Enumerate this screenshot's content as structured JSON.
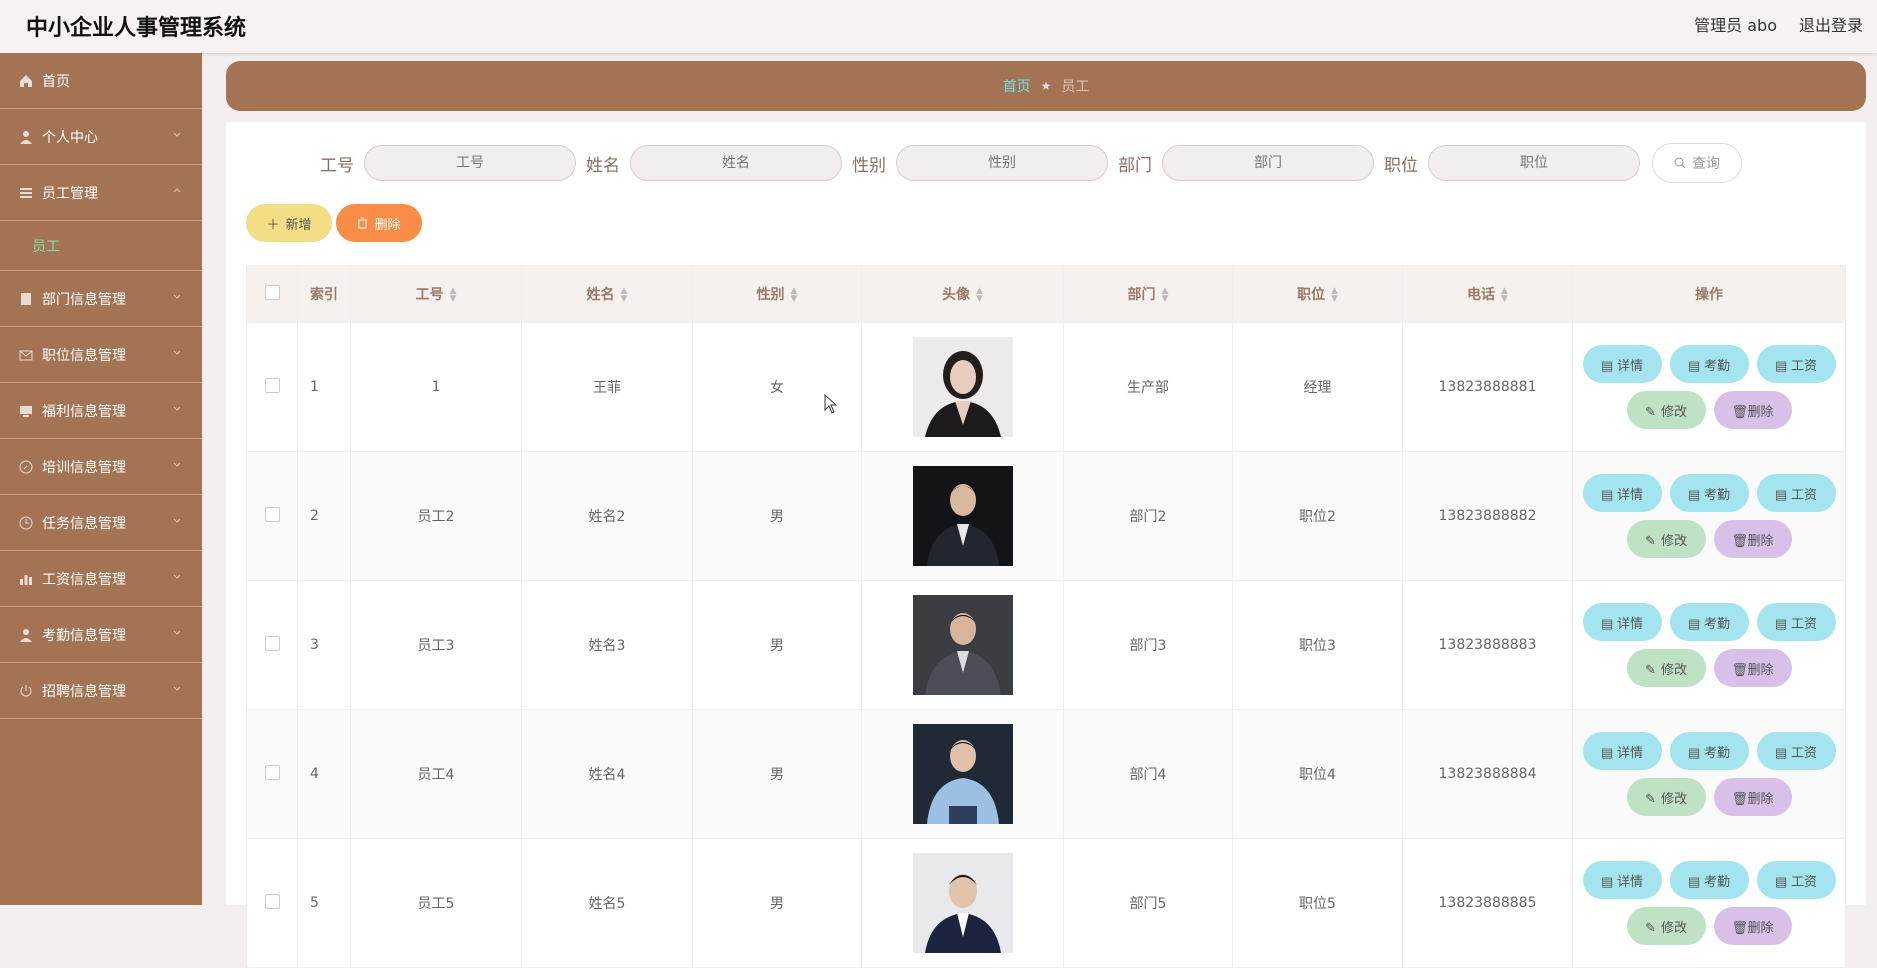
{
  "app": {
    "title": "中小企业人事管理系统",
    "user": "管理员 abo",
    "logout": "退出登录"
  },
  "sidebar": {
    "items": [
      {
        "label": "首页",
        "icon": "home-icon"
      },
      {
        "label": "个人中心",
        "icon": "user-icon"
      },
      {
        "label": "员工管理",
        "icon": "list-icon",
        "expanded": true,
        "sub": "员工"
      },
      {
        "label": "部门信息管理",
        "icon": "building-icon"
      },
      {
        "label": "职位信息管理",
        "icon": "mail-icon"
      },
      {
        "label": "福利信息管理",
        "icon": "monitor-icon"
      },
      {
        "label": "培训信息管理",
        "icon": "compass-icon"
      },
      {
        "label": "任务信息管理",
        "icon": "clock-icon"
      },
      {
        "label": "工资信息管理",
        "icon": "chart-icon"
      },
      {
        "label": "考勤信息管理",
        "icon": "user-icon"
      },
      {
        "label": "招聘信息管理",
        "icon": "power-icon"
      }
    ]
  },
  "breadcrumb": {
    "home": "首页",
    "current": "员工"
  },
  "search": {
    "fields": [
      {
        "label": "工号",
        "placeholder": "工号"
      },
      {
        "label": "姓名",
        "placeholder": "姓名"
      },
      {
        "label": "性别",
        "placeholder": "性别"
      },
      {
        "label": "部门",
        "placeholder": "部门"
      },
      {
        "label": "职位",
        "placeholder": "职位"
      }
    ],
    "query": "查询"
  },
  "actions": {
    "add": "新增",
    "delete": "删除"
  },
  "table": {
    "headers": [
      "索引",
      "工号",
      "姓名",
      "性别",
      "头像",
      "部门",
      "职位",
      "电话",
      "操作"
    ],
    "ops": {
      "detail": "详情",
      "attendance": "考勤",
      "salary": "工资",
      "edit": "修改",
      "delete": "删除"
    },
    "rows": [
      {
        "index": "1",
        "id": "1",
        "name": "王菲",
        "gender": "女",
        "dept": "生产部",
        "position": "经理",
        "phone": "13823888881"
      },
      {
        "index": "2",
        "id": "员工2",
        "name": "姓名2",
        "gender": "男",
        "dept": "部门2",
        "position": "职位2",
        "phone": "13823888882"
      },
      {
        "index": "3",
        "id": "员工3",
        "name": "姓名3",
        "gender": "男",
        "dept": "部门3",
        "position": "职位3",
        "phone": "13823888883"
      },
      {
        "index": "4",
        "id": "员工4",
        "name": "姓名4",
        "gender": "男",
        "dept": "部门4",
        "position": "职位4",
        "phone": "13823888884"
      },
      {
        "index": "5",
        "id": "员工5",
        "name": "姓名5",
        "gender": "男",
        "dept": "部门5",
        "position": "职位5",
        "phone": "13823888885"
      }
    ]
  },
  "colors": {
    "sidebar": "#a47354",
    "add": "#f3dd85",
    "delete": "#f98c46",
    "op_blue": "#a4e4ef",
    "op_green": "#bfe2c5",
    "op_purple": "#d8c0e8"
  }
}
